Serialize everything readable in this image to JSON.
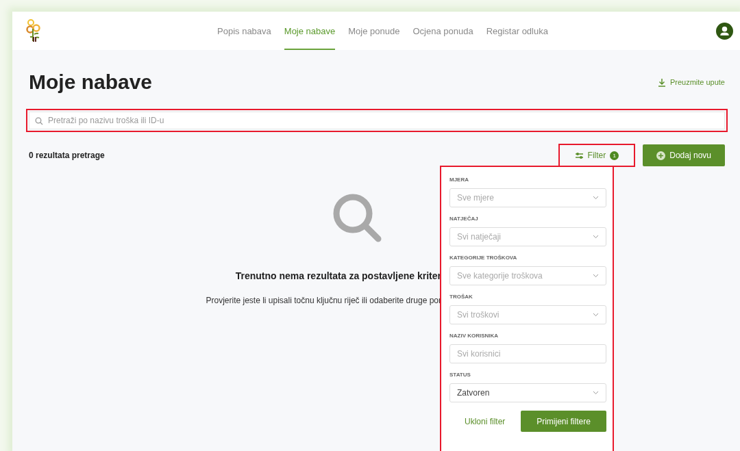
{
  "nav": {
    "items": [
      {
        "label": "Popis nabava",
        "selected": false
      },
      {
        "label": "Moje nabave",
        "selected": true
      },
      {
        "label": "Moje ponude",
        "selected": false
      },
      {
        "label": "Ocjena ponuda",
        "selected": false
      },
      {
        "label": "Registar odluka",
        "selected": false
      }
    ]
  },
  "page": {
    "title": "Moje nabave",
    "download_link": "Preuzmite upute"
  },
  "search": {
    "placeholder": "Pretraži po nazivu troška ili ID-u",
    "highlighted": true
  },
  "results": {
    "count_text": "0 rezultata pretrage"
  },
  "filter_button": {
    "label": "Filter",
    "badge": "1",
    "highlighted": true
  },
  "add_button": {
    "label": "Dodaj novu"
  },
  "empty_state": {
    "title": "Trenutno nema rezultata za postavljene kriter",
    "message": "Provjerite jeste li upisali točnu ključnu riječ ili odaberite druge por"
  },
  "filter_panel": {
    "highlighted": true,
    "fields": [
      {
        "kind": "select",
        "label": "MJERA",
        "placeholder": "Sve mjere"
      },
      {
        "kind": "select",
        "label": "NATJEČAJ",
        "placeholder": "Svi natječaji"
      },
      {
        "kind": "select",
        "label": "KATEGORIJE TROŠKOVA",
        "placeholder": "Sve kategorije troškova"
      },
      {
        "kind": "select",
        "label": "TROŠAK",
        "placeholder": "Svi troškovi"
      },
      {
        "kind": "input",
        "label": "NAZIV KORISNIKA",
        "placeholder": "Svi korisnici"
      },
      {
        "kind": "select",
        "label": "STATUS",
        "value": "Zatvoren"
      }
    ],
    "clear_button": "Ukloni filter",
    "apply_button": "Primijeni filtere"
  }
}
